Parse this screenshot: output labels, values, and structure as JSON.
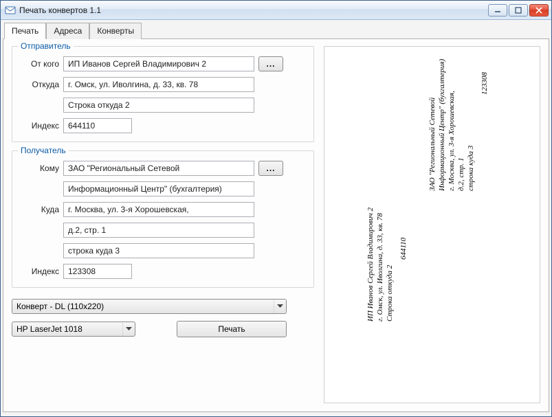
{
  "window": {
    "title": "Печать конвертов 1.1"
  },
  "tabs": {
    "print": "Печать",
    "addresses": "Адреса",
    "envelopes": "Конверты"
  },
  "sender": {
    "legend": "Отправитель",
    "from_label": "От кого",
    "from_value": "ИП Иванов Сергей Владимирович 2",
    "addr_label": "Откуда",
    "addr_line1": "г. Омск, ул. Иволгина, д. 33, кв. 78",
    "addr_line2": "Строка откуда 2",
    "index_label": "Индекс",
    "index_value": "644110",
    "dots": "..."
  },
  "recipient": {
    "legend": "Получатель",
    "to_label": "Кому",
    "to_line1": "ЗАО \"Региональный Сетевой",
    "to_line2": "Информационный Центр\" (бухгалтерия)",
    "addr_label": "Куда",
    "addr_line1": "г. Москва, ул. 3-я Хорошевская,",
    "addr_line2": "д.2, стр. 1",
    "addr_line3": "строка куда 3",
    "index_label": "Индекс",
    "index_value": "123308",
    "dots": "..."
  },
  "envelope_combo": "Конверт - DL (110x220)",
  "printer_combo": "HP LaserJet 1018",
  "print_button": "Печать",
  "preview": {
    "sender_block": [
      "ИП Иванов Сергей Владимирович 2",
      "г. Омск, ул. Иволгина, д. 33, кв. 78",
      "Строка откуда 2"
    ],
    "sender_index": "644110",
    "recipient_block": [
      "ЗАО \"Региональный Сетевой",
      "Информационный Центр\" (бухгалтерия)",
      "г. Москва, ул. 3-я Хорошевская,",
      "д.2, стр. 1",
      "строка куда 3"
    ],
    "recipient_index": "123308"
  }
}
